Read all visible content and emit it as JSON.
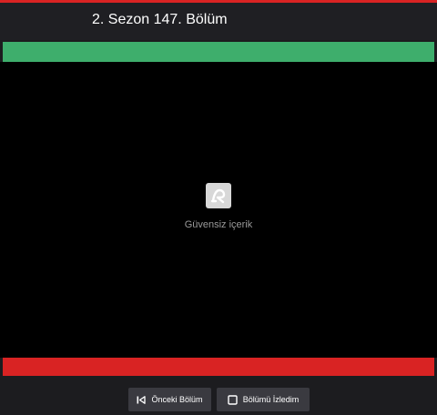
{
  "header": {
    "title": "2. Sezon 147. Bölüm"
  },
  "player": {
    "status_icon": "shield-alert-icon",
    "status_text": "Güvensiz içerik"
  },
  "footer": {
    "prev_label": "Önceki Bölüm",
    "prev_icon": "skip-previous-icon",
    "watched_label": "Bölümü İzledim",
    "watched_icon": "checkbox-empty-icon"
  },
  "colors": {
    "top_accent": "#d92323",
    "green_bar": "#3eae6c",
    "red_bar": "#d92323",
    "button_bg": "#3a3a40",
    "player_bg": "#000000"
  }
}
